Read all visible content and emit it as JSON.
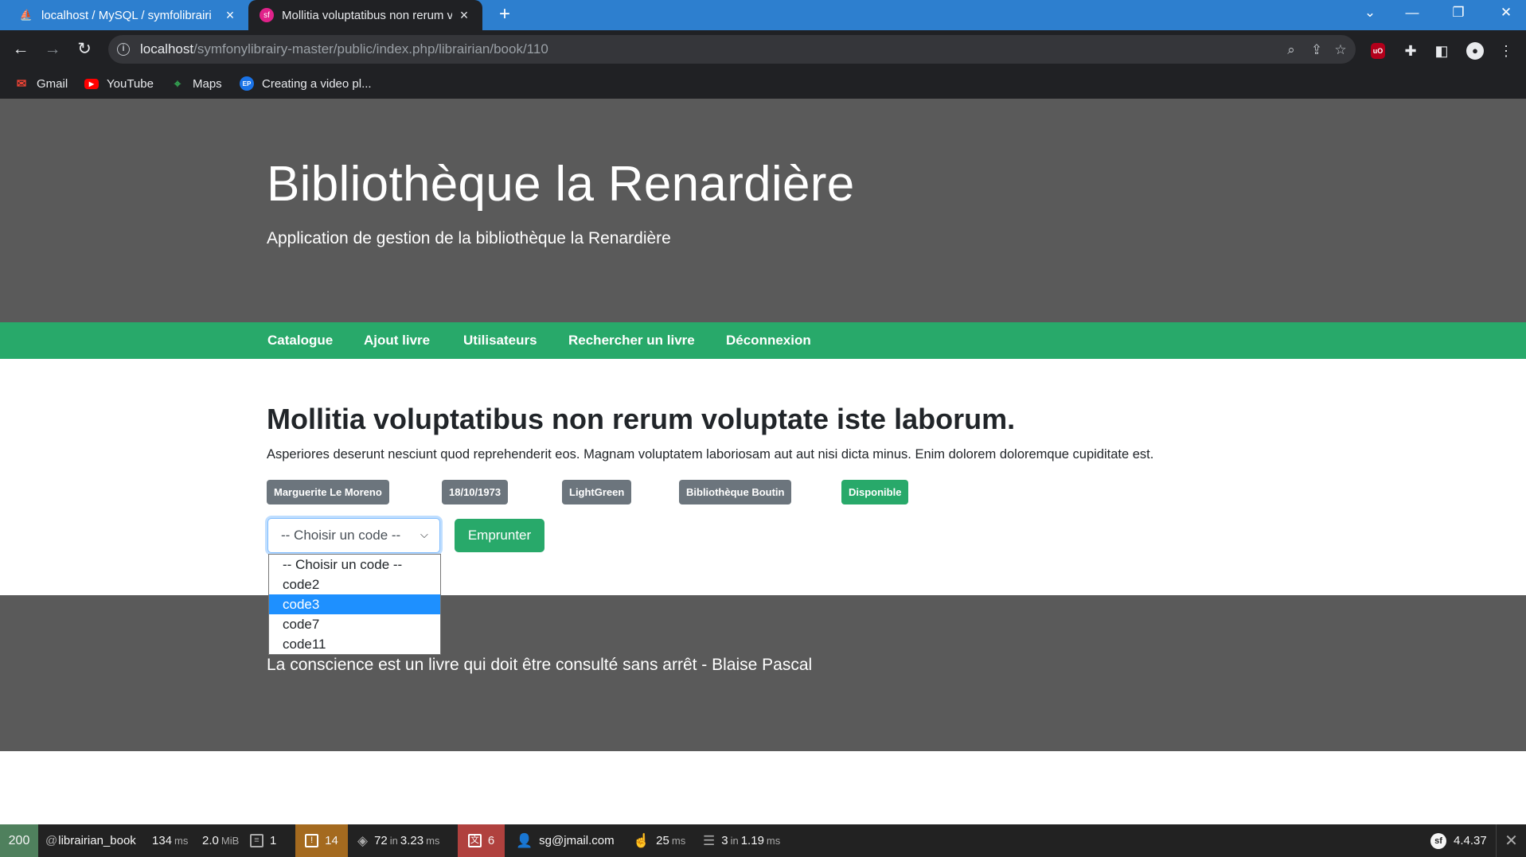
{
  "browser": {
    "tabs": [
      {
        "title": "localhost / MySQL / symfolibrairi",
        "favicon": "phpmyadmin-icon",
        "active": false
      },
      {
        "title": "Mollitia voluptatibus non rerum v",
        "favicon": "symfony-icon",
        "active": true
      }
    ],
    "url_host": "localhost",
    "url_path": "/symfonylibrairy-master/public/index.php/librairian/book/110",
    "bookmarks": [
      {
        "label": "Gmail",
        "icon": "gmail-icon"
      },
      {
        "label": "YouTube",
        "icon": "youtube-icon"
      },
      {
        "label": "Maps",
        "icon": "maps-icon"
      },
      {
        "label": "Creating a video pl...",
        "icon": "ep-icon",
        "icon_text": "EP"
      }
    ]
  },
  "site": {
    "title": "Bibliothèque la Renardière",
    "subtitle": "Application de gestion de la bibliothèque la Renardière"
  },
  "nav": {
    "items": [
      "Catalogue",
      "Ajout livre",
      "Utilisateurs",
      "Rechercher un livre",
      "Déconnexion"
    ]
  },
  "book": {
    "title": "Mollitia voluptatibus non rerum voluptate iste laborum.",
    "description": "Asperiores deserunt nesciunt quod reprehenderit eos. Magnam voluptatem laboriosam aut aut nisi dicta minus. Enim dolorem doloremque cupiditate est.",
    "badges": {
      "author": "Marguerite Le Moreno",
      "date": "18/10/1973",
      "color": "LightGreen",
      "library": "Bibliothèque Boutin",
      "status": "Disponible"
    }
  },
  "borrow": {
    "select_value": "-- Choisir un code --",
    "options": [
      "-- Choisir un code --",
      "code2",
      "code3",
      "code7",
      "code11"
    ],
    "highlighted_option": "code3",
    "button_label": "Emprunter"
  },
  "footer": {
    "quote": "La conscience est un livre qui doit être consulté sans arrêt - Blaise Pascal"
  },
  "debug_toolbar": {
    "status_code": "200",
    "route": "librairian_book",
    "time_value": "134",
    "time_unit": "ms",
    "memory_value": "2.0",
    "memory_unit": "MiB",
    "logs_count": "1",
    "warnings_count": "14",
    "twig_calls": "72",
    "twig_time": "3.23",
    "translation_count": "6",
    "user": "sg@jmail.com",
    "render_time": "25",
    "db_queries": "3",
    "db_time": "1.19",
    "symfony_version": "4.4.37"
  },
  "colors": {
    "browser_tabbar": "#2d7fcf",
    "page_header": "#5a5a5a",
    "navbar": "#28a96a",
    "badge": "#6c757d",
    "badge_success": "#28a96a",
    "option_highlight": "#1e90ff"
  }
}
